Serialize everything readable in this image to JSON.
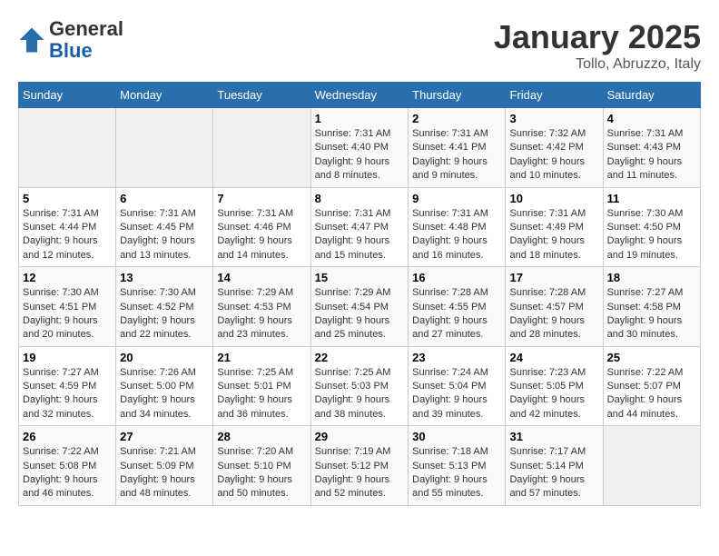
{
  "header": {
    "logo_line1": "General",
    "logo_line2": "Blue",
    "month": "January 2025",
    "location": "Tollo, Abruzzo, Italy"
  },
  "days_of_week": [
    "Sunday",
    "Monday",
    "Tuesday",
    "Wednesday",
    "Thursday",
    "Friday",
    "Saturday"
  ],
  "weeks": [
    [
      {
        "day": "",
        "info": ""
      },
      {
        "day": "",
        "info": ""
      },
      {
        "day": "",
        "info": ""
      },
      {
        "day": "1",
        "sunrise": "7:31 AM",
        "sunset": "4:40 PM",
        "daylight": "9 hours and 8 minutes."
      },
      {
        "day": "2",
        "sunrise": "7:31 AM",
        "sunset": "4:41 PM",
        "daylight": "9 hours and 9 minutes."
      },
      {
        "day": "3",
        "sunrise": "7:32 AM",
        "sunset": "4:42 PM",
        "daylight": "9 hours and 10 minutes."
      },
      {
        "day": "4",
        "sunrise": "7:31 AM",
        "sunset": "4:43 PM",
        "daylight": "9 hours and 11 minutes."
      }
    ],
    [
      {
        "day": "5",
        "sunrise": "7:31 AM",
        "sunset": "4:44 PM",
        "daylight": "9 hours and 12 minutes."
      },
      {
        "day": "6",
        "sunrise": "7:31 AM",
        "sunset": "4:45 PM",
        "daylight": "9 hours and 13 minutes."
      },
      {
        "day": "7",
        "sunrise": "7:31 AM",
        "sunset": "4:46 PM",
        "daylight": "9 hours and 14 minutes."
      },
      {
        "day": "8",
        "sunrise": "7:31 AM",
        "sunset": "4:47 PM",
        "daylight": "9 hours and 15 minutes."
      },
      {
        "day": "9",
        "sunrise": "7:31 AM",
        "sunset": "4:48 PM",
        "daylight": "9 hours and 16 minutes."
      },
      {
        "day": "10",
        "sunrise": "7:31 AM",
        "sunset": "4:49 PM",
        "daylight": "9 hours and 18 minutes."
      },
      {
        "day": "11",
        "sunrise": "7:30 AM",
        "sunset": "4:50 PM",
        "daylight": "9 hours and 19 minutes."
      }
    ],
    [
      {
        "day": "12",
        "sunrise": "7:30 AM",
        "sunset": "4:51 PM",
        "daylight": "9 hours and 20 minutes."
      },
      {
        "day": "13",
        "sunrise": "7:30 AM",
        "sunset": "4:52 PM",
        "daylight": "9 hours and 22 minutes."
      },
      {
        "day": "14",
        "sunrise": "7:29 AM",
        "sunset": "4:53 PM",
        "daylight": "9 hours and 23 minutes."
      },
      {
        "day": "15",
        "sunrise": "7:29 AM",
        "sunset": "4:54 PM",
        "daylight": "9 hours and 25 minutes."
      },
      {
        "day": "16",
        "sunrise": "7:28 AM",
        "sunset": "4:55 PM",
        "daylight": "9 hours and 27 minutes."
      },
      {
        "day": "17",
        "sunrise": "7:28 AM",
        "sunset": "4:57 PM",
        "daylight": "9 hours and 28 minutes."
      },
      {
        "day": "18",
        "sunrise": "7:27 AM",
        "sunset": "4:58 PM",
        "daylight": "9 hours and 30 minutes."
      }
    ],
    [
      {
        "day": "19",
        "sunrise": "7:27 AM",
        "sunset": "4:59 PM",
        "daylight": "9 hours and 32 minutes."
      },
      {
        "day": "20",
        "sunrise": "7:26 AM",
        "sunset": "5:00 PM",
        "daylight": "9 hours and 34 minutes."
      },
      {
        "day": "21",
        "sunrise": "7:25 AM",
        "sunset": "5:01 PM",
        "daylight": "9 hours and 36 minutes."
      },
      {
        "day": "22",
        "sunrise": "7:25 AM",
        "sunset": "5:03 PM",
        "daylight": "9 hours and 38 minutes."
      },
      {
        "day": "23",
        "sunrise": "7:24 AM",
        "sunset": "5:04 PM",
        "daylight": "9 hours and 39 minutes."
      },
      {
        "day": "24",
        "sunrise": "7:23 AM",
        "sunset": "5:05 PM",
        "daylight": "9 hours and 42 minutes."
      },
      {
        "day": "25",
        "sunrise": "7:22 AM",
        "sunset": "5:07 PM",
        "daylight": "9 hours and 44 minutes."
      }
    ],
    [
      {
        "day": "26",
        "sunrise": "7:22 AM",
        "sunset": "5:08 PM",
        "daylight": "9 hours and 46 minutes."
      },
      {
        "day": "27",
        "sunrise": "7:21 AM",
        "sunset": "5:09 PM",
        "daylight": "9 hours and 48 minutes."
      },
      {
        "day": "28",
        "sunrise": "7:20 AM",
        "sunset": "5:10 PM",
        "daylight": "9 hours and 50 minutes."
      },
      {
        "day": "29",
        "sunrise": "7:19 AM",
        "sunset": "5:12 PM",
        "daylight": "9 hours and 52 minutes."
      },
      {
        "day": "30",
        "sunrise": "7:18 AM",
        "sunset": "5:13 PM",
        "daylight": "9 hours and 55 minutes."
      },
      {
        "day": "31",
        "sunrise": "7:17 AM",
        "sunset": "5:14 PM",
        "daylight": "9 hours and 57 minutes."
      },
      {
        "day": "",
        "info": ""
      }
    ]
  ]
}
